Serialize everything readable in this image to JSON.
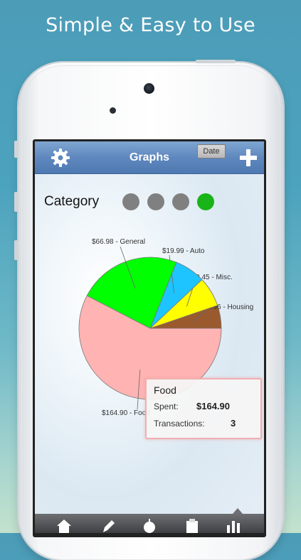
{
  "headline": "Simple & Easy to Use",
  "navbar": {
    "title": "Graphs",
    "date_button": "Date",
    "settings_icon": "gear-icon",
    "add_icon": "plus-icon"
  },
  "filter": {
    "label": "Category",
    "dots": [
      {
        "name": "option-1",
        "color": "#808080",
        "active": false
      },
      {
        "name": "option-2",
        "color": "#808080",
        "active": false
      },
      {
        "name": "option-3",
        "color": "#808080",
        "active": false
      },
      {
        "name": "option-4",
        "color": "#18b418",
        "active": true
      }
    ]
  },
  "chart_data": {
    "type": "pie",
    "title": "",
    "slices": [
      {
        "name": "Housing",
        "value": 14.96,
        "label": "$14.96 - Housing",
        "color": "#9a5a2e"
      },
      {
        "name": "Misc.",
        "value": 19.45,
        "label": "$19.45 - Misc.",
        "color": "#ffff00"
      },
      {
        "name": "Auto",
        "value": 19.99,
        "label": "$19.99 - Auto",
        "color": "#1ec4ff"
      },
      {
        "name": "General",
        "value": 66.98,
        "label": "$66.98 - General",
        "color": "#00ff00"
      },
      {
        "name": "Food",
        "value": 164.9,
        "label": "$164.90 - Food",
        "color": "#ffb3b3"
      }
    ]
  },
  "tooltip": {
    "title": "Food",
    "spent_label": "Spent:",
    "spent_value": "$164.90",
    "transactions_label": "Transactions:",
    "transactions_value": "3"
  },
  "tabbar": {
    "icons": [
      "home-icon",
      "pencil-icon",
      "apple-icon",
      "clipboard-icon",
      "bar-chart-icon"
    ]
  }
}
